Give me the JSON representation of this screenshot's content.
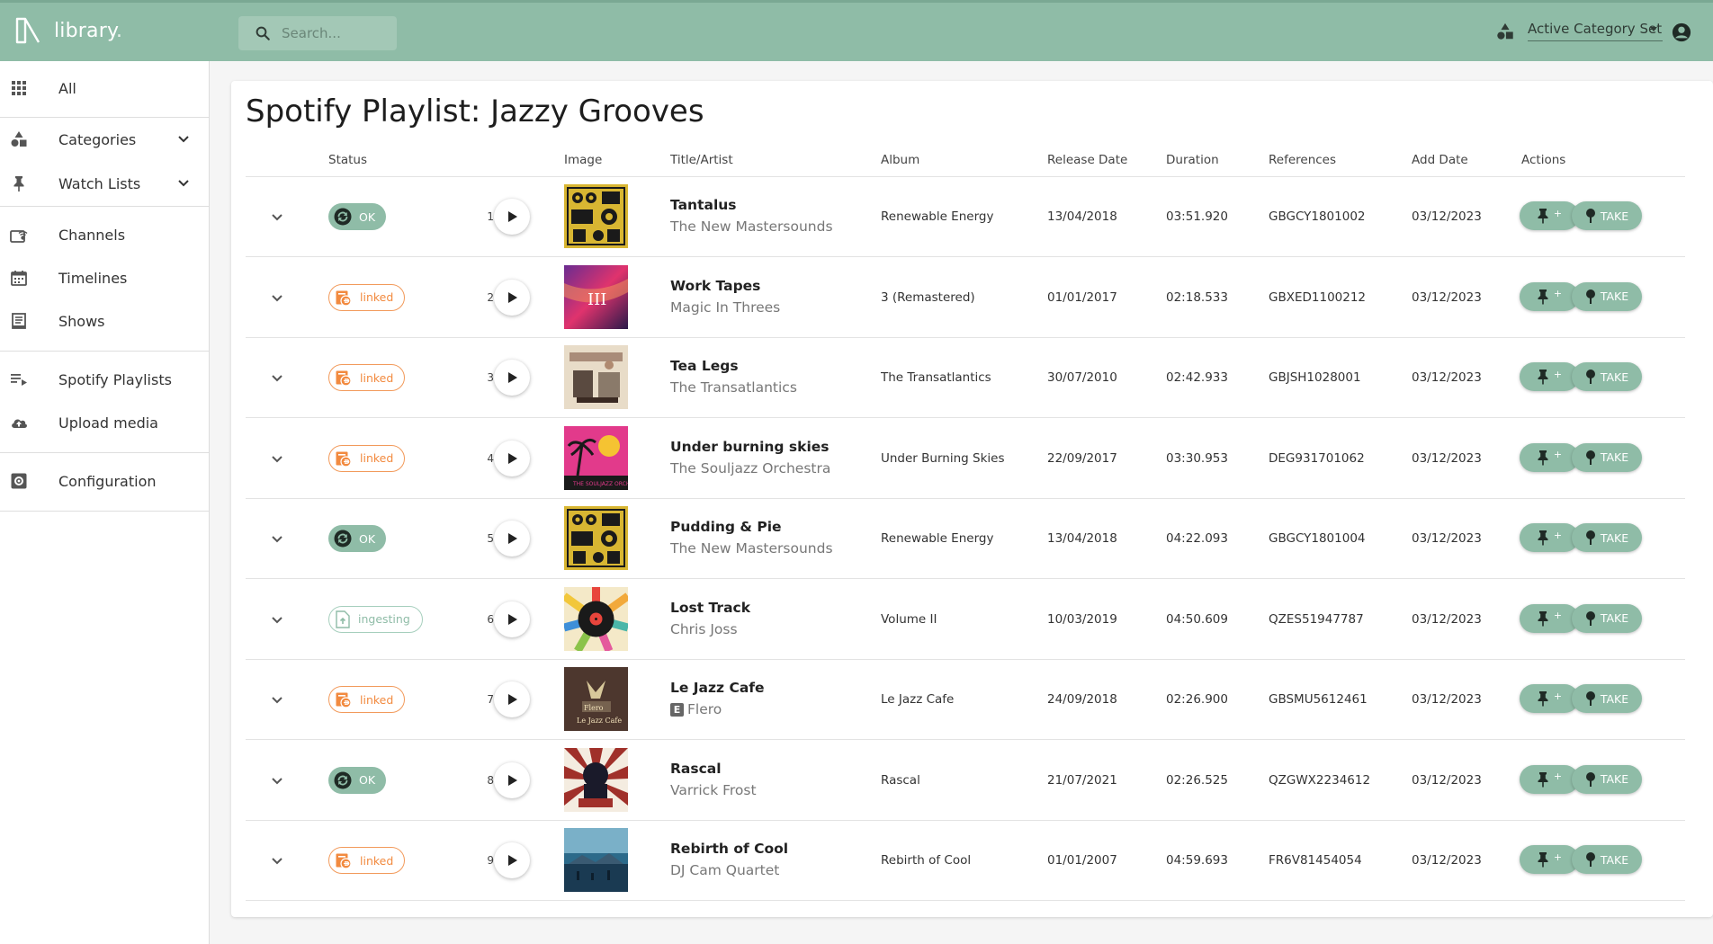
{
  "brand": {
    "name": "library",
    "dot": "."
  },
  "search": {
    "placeholder": "Search..."
  },
  "header": {
    "category_select_value": "Active Category Set"
  },
  "sidebar": {
    "items": [
      {
        "label": "All"
      },
      {
        "label": "Categories"
      },
      {
        "label": "Watch Lists"
      },
      {
        "label": "Channels"
      },
      {
        "label": "Timelines"
      },
      {
        "label": "Shows"
      },
      {
        "label": "Spotify Playlists"
      },
      {
        "label": "Upload media"
      },
      {
        "label": "Configuration"
      }
    ]
  },
  "page": {
    "title": "Spotify Playlist: Jazzy Grooves"
  },
  "table": {
    "columns": {
      "status": "Status",
      "image": "Image",
      "title_artist": "Title/Artist",
      "album": "Album",
      "release_date": "Release Date",
      "duration": "Duration",
      "references": "References",
      "add_date": "Add Date",
      "actions": "Actions"
    },
    "take_label": "TAKE",
    "pin_plus": "+",
    "rows": [
      {
        "num": "1",
        "status": "OK",
        "title": "Tantalus",
        "artist": "The New Mastersounds",
        "explicit": false,
        "album": "Renewable Energy",
        "release_date": "13/04/2018",
        "duration": "03:51.920",
        "reference": "GBGCY1801002",
        "add_date": "03/12/2023"
      },
      {
        "num": "2",
        "status": "linked",
        "title": "Work Tapes",
        "artist": "Magic In Threes",
        "explicit": false,
        "album": "3 (Remastered)",
        "release_date": "01/01/2017",
        "duration": "02:18.533",
        "reference": "GBXED1100212",
        "add_date": "03/12/2023"
      },
      {
        "num": "3",
        "status": "linked",
        "title": "Tea Legs",
        "artist": "The Transatlantics",
        "explicit": false,
        "album": "The Transatlantics",
        "release_date": "30/07/2010",
        "duration": "02:42.933",
        "reference": "GBJSH1028001",
        "add_date": "03/12/2023"
      },
      {
        "num": "4",
        "status": "linked",
        "title": "Under burning skies",
        "artist": "The Souljazz Orchestra",
        "explicit": false,
        "album": "Under Burning Skies",
        "release_date": "22/09/2017",
        "duration": "03:30.953",
        "reference": "DEG931701062",
        "add_date": "03/12/2023"
      },
      {
        "num": "5",
        "status": "OK",
        "title": "Pudding & Pie",
        "artist": "The New Mastersounds",
        "explicit": false,
        "album": "Renewable Energy",
        "release_date": "13/04/2018",
        "duration": "04:22.093",
        "reference": "GBGCY1801004",
        "add_date": "03/12/2023"
      },
      {
        "num": "6",
        "status": "ingesting",
        "title": "Lost Track",
        "artist": "Chris Joss",
        "explicit": false,
        "album": "Volume II",
        "release_date": "10/03/2019",
        "duration": "04:50.609",
        "reference": "QZES51947787",
        "add_date": "03/12/2023"
      },
      {
        "num": "7",
        "status": "linked",
        "title": "Le Jazz Cafe",
        "artist": "Flero",
        "explicit": true,
        "explicit_label": "E",
        "album": "Le Jazz Cafe",
        "release_date": "24/09/2018",
        "duration": "02:26.900",
        "reference": "GBSMU5612461",
        "add_date": "03/12/2023"
      },
      {
        "num": "8",
        "status": "OK",
        "title": "Rascal",
        "artist": "Varrick Frost",
        "explicit": false,
        "album": "Rascal",
        "release_date": "21/07/2021",
        "duration": "02:26.525",
        "reference": "QZGWX2234612",
        "add_date": "03/12/2023"
      },
      {
        "num": "9",
        "status": "linked",
        "title": "Rebirth of Cool",
        "artist": "DJ Cam Quartet",
        "explicit": false,
        "album": "Rebirth of Cool",
        "release_date": "01/01/2007",
        "duration": "04:59.693",
        "reference": "FR6V81454054",
        "add_date": "03/12/2023"
      }
    ]
  },
  "colors": {
    "brand_green": "#8fbca7",
    "linked_orange": "#f28a3f",
    "ingesting_green": "#a6cfbd"
  }
}
